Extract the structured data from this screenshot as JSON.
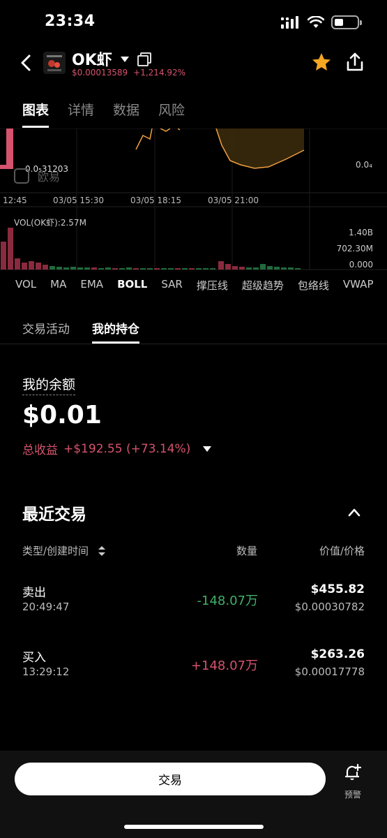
{
  "status_bar": {
    "time": "23:34"
  },
  "header": {
    "title": "OK虾",
    "price": "$0.00013589",
    "change": "+1,214.92%"
  },
  "main_tabs": [
    {
      "label": "图表",
      "active": true
    },
    {
      "label": "详情",
      "active": false
    },
    {
      "label": "数据",
      "active": false
    },
    {
      "label": "风险",
      "active": false
    }
  ],
  "chart": {
    "low_label": "0.0₅31203",
    "right_label": "0.0₄",
    "watermark": "欧易",
    "time_ticks": [
      "12:45",
      "03/05 15:30",
      "03/05 18:15",
      "03/05 21:00"
    ],
    "volume_label": "VOL(OK虾):2.57M",
    "volume_scale": [
      "1.40B",
      "702.30M",
      "0.000"
    ]
  },
  "indicators": [
    "VOL",
    "MA",
    "EMA",
    "BOLL",
    "SAR",
    "撑压线",
    "超级趋势",
    "包络线",
    "VWAP"
  ],
  "active_indicator": "BOLL",
  "sub_tabs": [
    {
      "label": "交易活动",
      "active": false
    },
    {
      "label": "我的持仓",
      "active": true
    }
  ],
  "balance": {
    "label": "我的余额",
    "value": "$0.01",
    "pnl_label": "总收益",
    "pnl_value": "+$192.55 (+73.14%)"
  },
  "recent_trades": {
    "title": "最近交易",
    "headers": {
      "type": "类型/创建时间",
      "qty": "数量",
      "value": "价值/价格"
    },
    "rows": [
      {
        "side": "卖出",
        "time": "20:49:47",
        "qty": "-148.07万",
        "value": "$455.82",
        "price": "$0.00030782",
        "direction": "sell"
      },
      {
        "side": "买入",
        "time": "13:29:12",
        "qty": "+148.07万",
        "value": "$263.26",
        "price": "$0.00017778",
        "direction": "buy"
      }
    ]
  },
  "bottom": {
    "trade_button": "交易",
    "alert_label": "预警"
  },
  "colors": {
    "up": "#d6536d",
    "down": "#3fb067",
    "accent_star": "#f5a623"
  }
}
